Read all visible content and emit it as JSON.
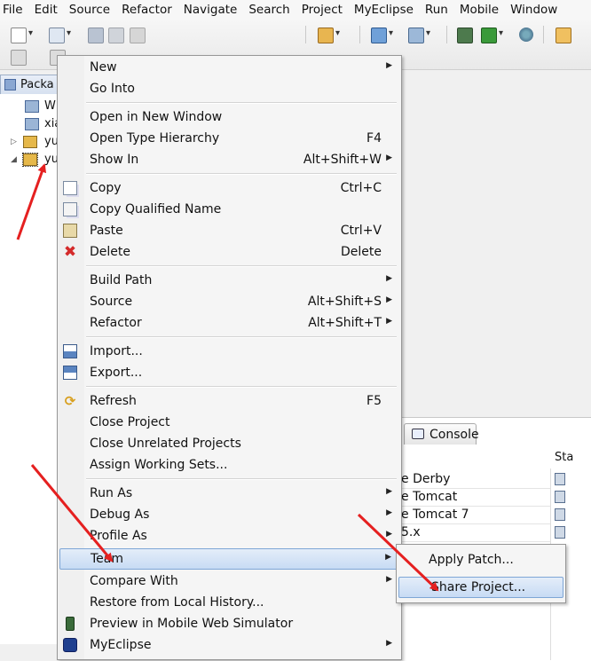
{
  "menubar": [
    "File",
    "Edit",
    "Source",
    "Refactor",
    "Navigate",
    "Search",
    "Project",
    "MyEclipse",
    "Run",
    "Mobile",
    "Window"
  ],
  "package_explorer": {
    "tab_label": "Packa",
    "rows": [
      {
        "label": "W",
        "icon": "folder-icon"
      },
      {
        "label": "xia",
        "icon": "folder-icon"
      },
      {
        "label": "yu",
        "icon": "web-project-icon"
      },
      {
        "label": "yu",
        "icon": "web-project-icon"
      }
    ]
  },
  "context_menu": {
    "items": [
      {
        "label": "New",
        "submenu": true
      },
      {
        "label": "Go Into"
      },
      {
        "label": "Open in New Window"
      },
      {
        "label": "Open Type Hierarchy",
        "shortcut": "F4"
      },
      {
        "label": "Show In",
        "shortcut": "Alt+Shift+W",
        "submenu": true
      },
      {
        "label": "Copy",
        "shortcut": "Ctrl+C",
        "icon": "copy-icon"
      },
      {
        "label": "Copy Qualified Name",
        "icon": "copy-qualified-icon"
      },
      {
        "label": "Paste",
        "shortcut": "Ctrl+V",
        "icon": "paste-icon"
      },
      {
        "label": "Delete",
        "shortcut": "Delete",
        "icon": "delete-icon"
      },
      {
        "label": "Build Path",
        "submenu": true
      },
      {
        "label": "Source",
        "shortcut": "Alt+Shift+S",
        "submenu": true
      },
      {
        "label": "Refactor",
        "shortcut": "Alt+Shift+T",
        "submenu": true
      },
      {
        "label": "Import...",
        "icon": "import-icon"
      },
      {
        "label": "Export...",
        "icon": "export-icon"
      },
      {
        "label": "Refresh",
        "shortcut": "F5",
        "icon": "refresh-icon"
      },
      {
        "label": "Close Project"
      },
      {
        "label": "Close Unrelated Projects"
      },
      {
        "label": "Assign Working Sets..."
      },
      {
        "label": "Run As",
        "submenu": true
      },
      {
        "label": "Debug As",
        "submenu": true
      },
      {
        "label": "Profile As",
        "submenu": true
      },
      {
        "label": "Team",
        "submenu": true,
        "highlighted": true
      },
      {
        "label": "Compare With",
        "submenu": true
      },
      {
        "label": "Restore from Local History..."
      },
      {
        "label": "Preview in Mobile Web Simulator",
        "icon": "mobile-preview-icon"
      },
      {
        "label": "MyEclipse",
        "submenu": true,
        "icon": "myeclipse-icon"
      }
    ]
  },
  "team_submenu": {
    "items": [
      {
        "label": "Apply Patch..."
      },
      {
        "label": "Share Project...",
        "highlighted": true
      }
    ]
  },
  "servers_panel": {
    "tab_label": "Console",
    "status_header": "Sta",
    "rows": [
      "e Derby",
      "e Tomcat",
      "e Tomcat 7",
      "5.x"
    ]
  },
  "colors": {
    "highlight": "#c7dbf4",
    "annotation_arrow": "#e52020"
  }
}
